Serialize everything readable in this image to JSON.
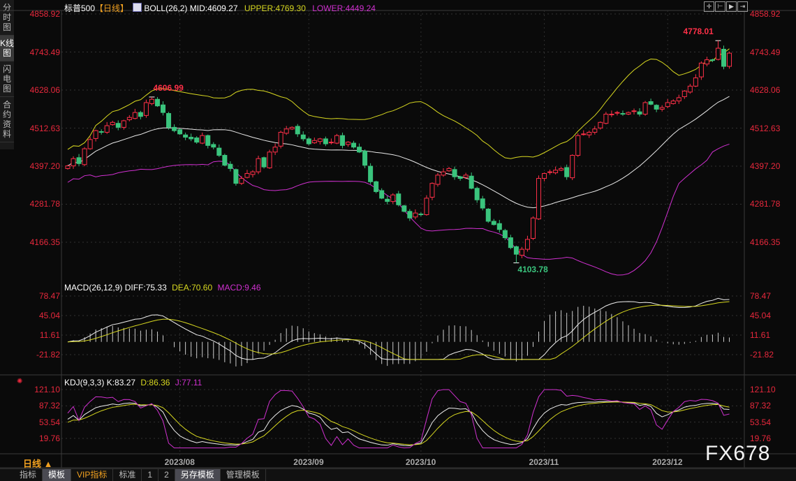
{
  "sidebar": {
    "tabs": [
      {
        "label": "分时图"
      },
      {
        "label": "K线图"
      },
      {
        "label": "闪电图"
      },
      {
        "label": "合约资料"
      }
    ]
  },
  "header": {
    "symbol": "标普500",
    "period": "【日线】",
    "boll_name": "BOLL(26,2)",
    "mid": "MID:4609.27",
    "upper": "UPPER:4769.30",
    "lower": "LOWER:4449.24"
  },
  "toolbar": {
    "icons": [
      "crosshair-icon",
      "zoom-range-icon",
      "play-step-icon",
      "jump-end-icon"
    ]
  },
  "macd_header": {
    "name": "MACD(26,12,9)",
    "diff": "DIFF:75.33",
    "dea": "DEA:70.60",
    "macd": "MACD:9.46"
  },
  "kdj_header": {
    "name": "KDJ(9,3,3)",
    "k": "K:83.27",
    "d": "D:86.36",
    "j": "J:77.11"
  },
  "period_label": "日线 ▲",
  "watermark": "FX678",
  "bottom_tabs": [
    {
      "label": "指标"
    },
    {
      "label": "模板"
    },
    {
      "label": "VIP指标"
    },
    {
      "label": "标准"
    },
    {
      "label": "1"
    },
    {
      "label": "2"
    },
    {
      "label": "另存模板"
    },
    {
      "label": "管理模板"
    }
  ],
  "colors": {
    "up": "#ff3048",
    "down": "#3ac47d",
    "mid": "#e8e8e8",
    "upper": "#d8d820",
    "lower": "#d030d0",
    "axis": "#e8283c"
  },
  "chart_data": {
    "type": "candlestick",
    "title": "标普500 日线",
    "price_axis": {
      "ticks": [
        "4858.92",
        "4743.49",
        "4628.06",
        "4512.63",
        "4397.20",
        "4281.78",
        "4166.35"
      ],
      "range": [
        4166.35,
        4858.92
      ]
    },
    "macd_axis": {
      "ticks": [
        "78.47",
        "45.04",
        "11.61",
        "-21.82"
      ],
      "range": [
        -21.82,
        78.47
      ]
    },
    "kdj_axis": {
      "ticks": [
        "121.10",
        "87.32",
        "53.54",
        "19.76"
      ],
      "range": [
        19.76,
        121.1
      ]
    },
    "x_ticks": [
      {
        "label": "2023/08",
        "index": 20
      },
      {
        "label": "2023/09",
        "index": 43
      },
      {
        "label": "2023/10",
        "index": 63
      },
      {
        "label": "2023/11",
        "index": 85
      },
      {
        "label": "2023/12",
        "index": 107
      }
    ],
    "annotations": [
      {
        "label": "4606.99",
        "value": 4606.99,
        "index": 15,
        "kind": "high"
      },
      {
        "label": "4103.78",
        "value": 4103.78,
        "index": 80,
        "kind": "low"
      },
      {
        "label": "4778.01",
        "value": 4778.01,
        "index": 116,
        "kind": "high"
      }
    ],
    "closes": [
      4398,
      4420,
      4405,
      4450,
      4478,
      4505,
      4500,
      4520,
      4530,
      4515,
      4535,
      4545,
      4560,
      4548,
      4590,
      4600,
      4580,
      4560,
      4515,
      4505,
      4495,
      4485,
      4480,
      4470,
      4490,
      4460,
      4455,
      4430,
      4400,
      4390,
      4345,
      4360,
      4375,
      4380,
      4420,
      4395,
      4440,
      4455,
      4500,
      4510,
      4515,
      4495,
      4480,
      4465,
      4475,
      4480,
      4465,
      4470,
      4490,
      4460,
      4470,
      4455,
      4440,
      4400,
      4350,
      4320,
      4300,
      4290,
      4310,
      4280,
      4260,
      4240,
      4255,
      4250,
      4300,
      4345,
      4370,
      4380,
      4390,
      4365,
      4360,
      4370,
      4330,
      4295,
      4270,
      4230,
      4220,
      4205,
      4180,
      4150,
      4130,
      4145,
      4175,
      4240,
      4360,
      4375,
      4380,
      4385,
      4390,
      4365,
      4430,
      4490,
      4495,
      4500,
      4510,
      4530,
      4555,
      4555,
      4560,
      4555,
      4560,
      4565,
      4555,
      4590,
      4585,
      4570,
      4575,
      4590,
      4595,
      4605,
      4625,
      4640,
      4665,
      4710,
      4720,
      4718,
      4755,
      4700,
      4740
    ],
    "indicators": {
      "boll": {
        "period": 26,
        "k": 2
      },
      "macd": {
        "fast": 12,
        "slow": 26,
        "signal": 9
      },
      "kdj": {
        "n": 9,
        "m1": 3,
        "m2": 3
      }
    }
  }
}
